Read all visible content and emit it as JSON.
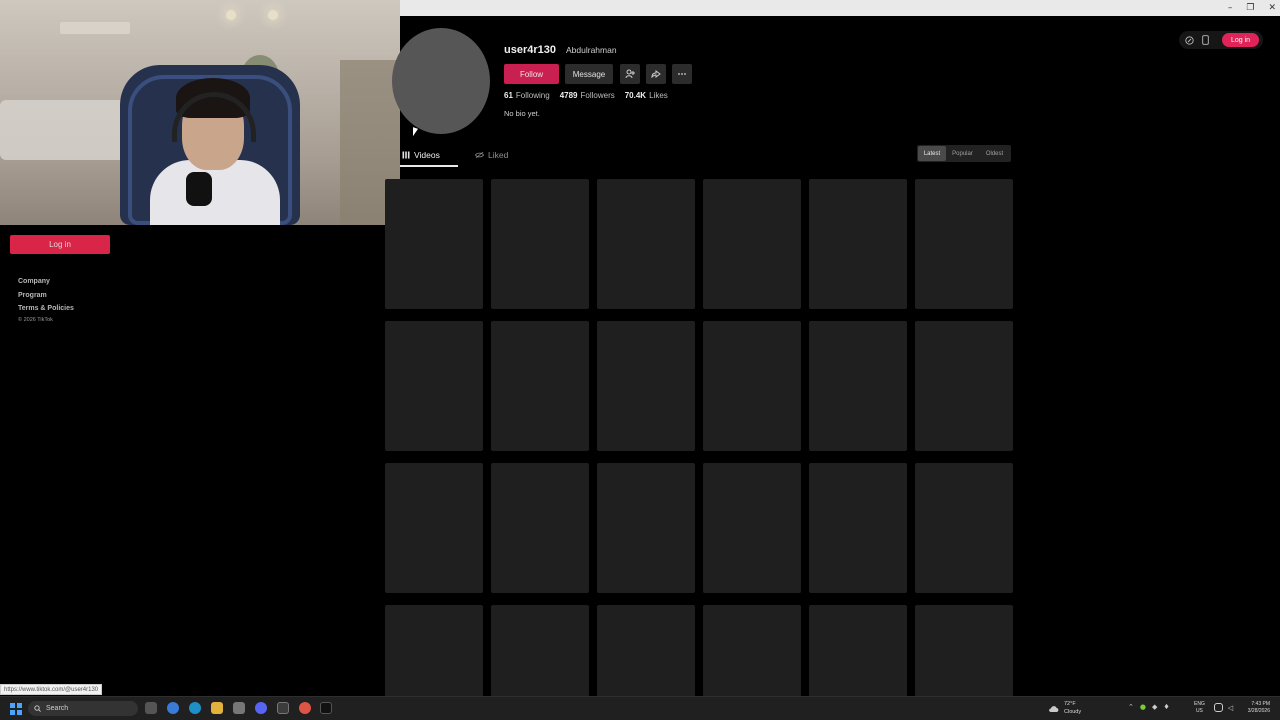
{
  "window": {
    "controls": {
      "minimize": "–",
      "restore": "❐",
      "close": "✕"
    }
  },
  "sidebar": {
    "login_label": "Log in",
    "links": [
      "Company",
      "Program",
      "Terms & Policies"
    ],
    "copyright": "© 2026 TikTok"
  },
  "header": {
    "login_label": "Log in"
  },
  "profile": {
    "username": "user4r130",
    "display_name": "Abdulrahman",
    "follow_label": "Follow",
    "message_label": "Message",
    "following_count": "61",
    "following_label": "Following",
    "followers_count": "4789",
    "followers_label": "Followers",
    "likes_count": "70.4K",
    "likes_label": "Likes",
    "bio": "No bio yet."
  },
  "tabs": {
    "videos_label": "Videos",
    "liked_label": "Liked"
  },
  "sort": {
    "latest": "Latest",
    "popular": "Popular",
    "oldest": "Oldest",
    "selected": "Latest"
  },
  "status_bar": {
    "url": "https://www.tiktok.com/@user4r130"
  },
  "taskbar": {
    "search_placeholder": "Search",
    "weather_temp": "72°F",
    "weather_desc": "Cloudy",
    "lang_top": "ENG",
    "lang_bottom": "US",
    "time": "7:43 PM",
    "date": "3/28/2026"
  },
  "icons": {
    "add_friend": "add-friend-icon",
    "share": "share-icon",
    "more": "more-icon",
    "grid": "grid-icon",
    "eye_slash": "eye-slash-icon"
  }
}
